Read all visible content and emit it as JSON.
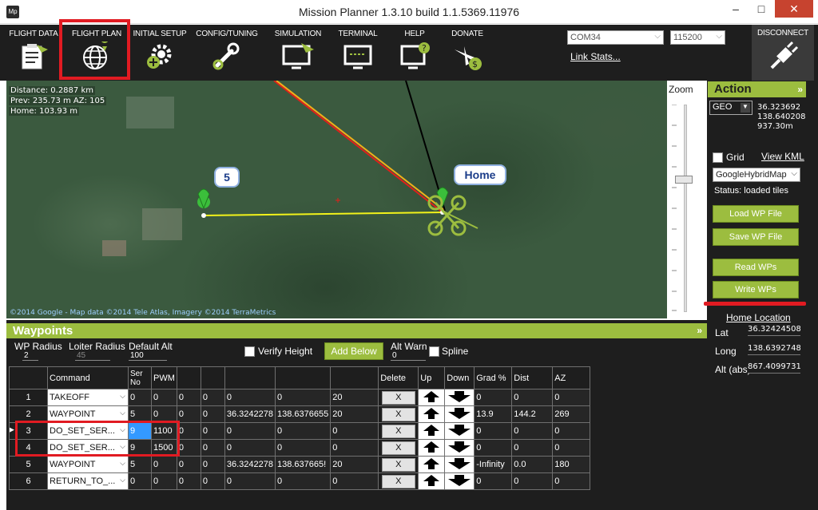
{
  "window": {
    "app_icon": "Mp",
    "title": "Mission Planner 1.3.10 build 1.1.5369.11976",
    "min": "–",
    "max": "□",
    "close": "✕"
  },
  "menu": [
    {
      "label": "FLIGHT DATA",
      "icon": "clipboard-plane-icon"
    },
    {
      "label": "FLIGHT PLAN",
      "icon": "globe-pin-icon"
    },
    {
      "label": "INITIAL SETUP",
      "icon": "gear-plus-icon"
    },
    {
      "label": "CONFIG/TUNING",
      "icon": "wrench-icon"
    },
    {
      "label": "SIMULATION",
      "icon": "monitor-plane-icon"
    },
    {
      "label": "TERMINAL",
      "icon": "terminal-icon"
    },
    {
      "label": "HELP",
      "icon": "monitor-question-icon"
    },
    {
      "label": "DONATE",
      "icon": "plane-dollar-icon"
    }
  ],
  "connection": {
    "port": "COM34",
    "baud": "115200",
    "link_stats": "Link Stats...",
    "disconnect_label": "DISCONNECT"
  },
  "map": {
    "distance": "Distance: 0.2887 km",
    "prev": "Prev: 235.73 m AZ: 105",
    "home": "Home: 103.93 m",
    "wp_label_5": "5",
    "wp_label_home": "Home",
    "copyright": "©2014 Google - Map data ©2014 Tele Atlas, Imagery ©2014 TerraMetrics"
  },
  "zoom": {
    "label": "Zoom",
    "level_fraction": 0.36
  },
  "action": {
    "title": "Action",
    "chevron": "»",
    "coord_mode": "GEO",
    "lat": "36.323692",
    "lng": "138.640208",
    "alt": "937.30m",
    "grid_label": "Grid",
    "view_kml": "View KML",
    "map_type": "GoogleHybridMap",
    "status": "Status: loaded tiles",
    "load_wp_file": "Load WP File",
    "save_wp_file": "Save WP File",
    "read_wps": "Read WPs",
    "write_wps": "Write WPs",
    "home_location": "Home Location",
    "lat_label": "Lat",
    "lat_value": "36.3242450840",
    "long_label": "Long",
    "long_value": "138.6392748300",
    "alt_label": "Alt (abs)",
    "alt_value": "867.4099731400"
  },
  "waypoints": {
    "title": "Waypoints",
    "chevron": "»",
    "wp_radius_label": "WP Radius",
    "wp_radius_value": "2",
    "loiter_radius_label": "Loiter Radius",
    "loiter_radius_value": "45",
    "default_alt_label": "Default Alt",
    "default_alt_value": "100",
    "verify_height": "Verify Height",
    "add_below": "Add Below",
    "alt_warn_label": "Alt Warn",
    "alt_warn_value": "0",
    "spline": "Spline",
    "columns": [
      "",
      "Command",
      "Ser No",
      "PWM",
      "",
      "",
      "",
      "",
      "",
      "Delete",
      "Up",
      "Down",
      "Grad %",
      "Dist",
      "AZ"
    ],
    "rows": [
      {
        "no": "1",
        "command": "TAKEOFF",
        "c1": "0",
        "c2": "0",
        "c3": "0",
        "c4": "0",
        "lat": "0",
        "lng": "0",
        "alt": "20",
        "grad": "0",
        "dist": "0",
        "az": "0"
      },
      {
        "no": "2",
        "command": "WAYPOINT",
        "c1": "5",
        "c2": "0",
        "c3": "0",
        "c4": "0",
        "lat": "36.3242278",
        "lng": "138.6376655",
        "alt": "20",
        "grad": "13.9",
        "dist": "144.2",
        "az": "269"
      },
      {
        "no": "3",
        "command": "DO_SET_SER...",
        "c1": "9",
        "c2": "1100",
        "c3": "0",
        "c4": "0",
        "lat": "0",
        "lng": "0",
        "alt": "0",
        "grad": "0",
        "dist": "0",
        "az": "0"
      },
      {
        "no": "4",
        "command": "DO_SET_SER...",
        "c1": "9",
        "c2": "1500",
        "c3": "0",
        "c4": "0",
        "lat": "0",
        "lng": "0",
        "alt": "0",
        "grad": "0",
        "dist": "0",
        "az": "0"
      },
      {
        "no": "5",
        "command": "WAYPOINT",
        "c1": "5",
        "c2": "0",
        "c3": "0",
        "c4": "0",
        "lat": "36.3242278",
        "lng": "138.637665!",
        "alt": "20",
        "grad": "-Infinity",
        "dist": "0.0",
        "az": "180"
      },
      {
        "no": "6",
        "command": "RETURN_TO_...",
        "c1": "0",
        "c2": "0",
        "c3": "0",
        "c4": "0",
        "lat": "0",
        "lng": "0",
        "alt": "0",
        "grad": "0",
        "dist": "0",
        "az": "0"
      }
    ],
    "delete_label": "X"
  },
  "colors": {
    "accent": "#9cbd3f",
    "highlight": "#e11b22",
    "panel": "#1e1e1e"
  }
}
